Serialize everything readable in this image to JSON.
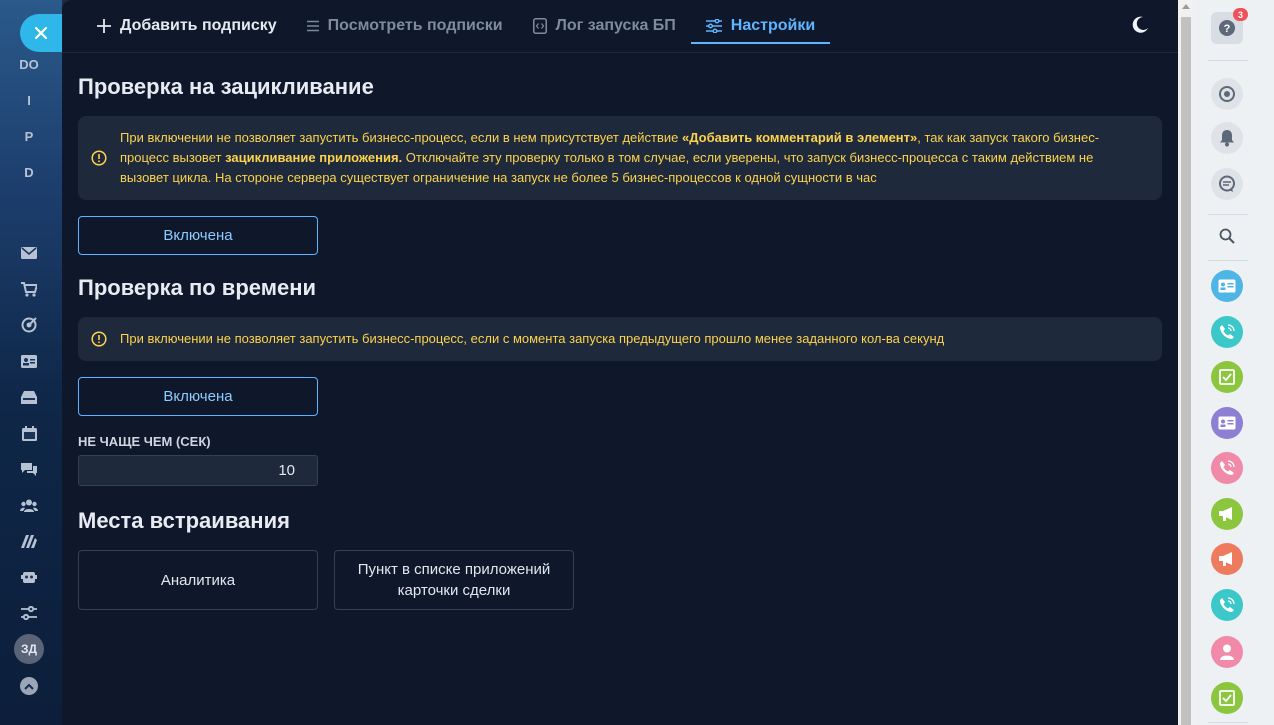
{
  "left_sidebar": {
    "letters": [
      "DO",
      "I",
      "P",
      "D"
    ],
    "icons": [
      "mail-icon",
      "cart-icon",
      "target-icon",
      "contact-card-icon",
      "inbox-icon",
      "calendar-icon",
      "chat-icon",
      "team-icon",
      "logo-m-icon",
      "robot-icon",
      "sliders-icon"
    ],
    "avatar_text": "ЗД"
  },
  "tabs": [
    {
      "label": "Добавить подписку",
      "icon": "plus-icon"
    },
    {
      "label": "Посмотреть подписки",
      "icon": "list-icon"
    },
    {
      "label": "Лог запуска БП",
      "icon": "code-file-icon"
    },
    {
      "label": "Настройки",
      "icon": "sliders-icon",
      "active": true
    }
  ],
  "sections": {
    "loop_check": {
      "title": "Проверка на зацикливание",
      "notice": {
        "part1": "При включении не позволяет запустить бизнесс-процесс, если в нем присутствует действие ",
        "bold1": "«Добавить комментарий в элемент»",
        "part2": ", так как запуск такого бизнес-процесс вызовет ",
        "bold2": "зацикливание приложения.",
        "part3": " Отключайте эту проверку только в том случае, если уверены, что запуск бизнесс-процесса с таким действием не вызовет цикла. На стороне сервера существует ограничение на запуск не более 5 бизнес-процессов к одной сущности в час"
      },
      "button_label": "Включена"
    },
    "time_check": {
      "title": "Проверка по времени",
      "notice": "При включении не позволяет запустить бизнесс-процесс, если с момента запуска предыдущего прошло менее заданного кол-ва секунд",
      "button_label": "Включена",
      "field_label": "НЕ ЧАЩЕ ЧЕМ (СЕК)",
      "field_value": "10"
    },
    "embed_places": {
      "title": "Места встраивания",
      "cards": [
        "Аналитика",
        "Пункт в списке приложений карточки сделки"
      ]
    }
  },
  "right_rail": {
    "help_badge": "3",
    "colors": {
      "blue": "#4fb4e6",
      "teal": "#3cc8c8",
      "green": "#8cc63f",
      "purple": "#8c7fd4",
      "pink": "#f08aa8",
      "orange": "#ef7b5e"
    }
  },
  "colors": {
    "panel_bg": "#0f172a",
    "notice_bg": "#1e293b",
    "accent": "#60b4ff",
    "warning_text": "#fcd34d"
  }
}
